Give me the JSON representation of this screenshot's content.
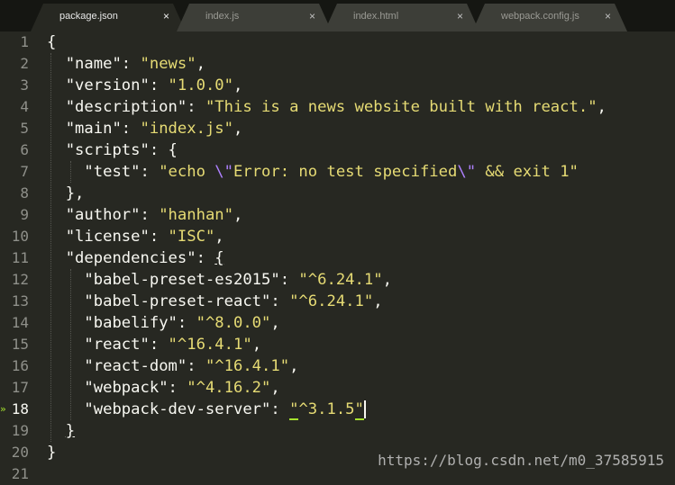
{
  "tabs": [
    {
      "label": "package.json",
      "active": true
    },
    {
      "label": "index.js",
      "active": false
    },
    {
      "label": "index.html",
      "active": false
    },
    {
      "label": "webpack.config.js",
      "active": false
    }
  ],
  "tab_close_glyph": "×",
  "gutter": {
    "lines": [
      "1",
      "2",
      "3",
      "4",
      "5",
      "6",
      "7",
      "8",
      "9",
      "10",
      "11",
      "12",
      "13",
      "14",
      "15",
      "16",
      "17",
      "18",
      "19",
      "20",
      "21"
    ],
    "current_line": "18",
    "change_marker": "»"
  },
  "code": {
    "l1": "{",
    "l2_k": "\"name\"",
    "l2_v": "\"news\"",
    "l3_k": "\"version\"",
    "l3_v": "\"1.0.0\"",
    "l4_k": "\"description\"",
    "l4_v": "\"This is a news website built with react.\"",
    "l5_k": "\"main\"",
    "l5_v": "\"index.js\"",
    "l6_k": "\"scripts\"",
    "l7_k": "\"test\"",
    "l7_v1": "\"echo ",
    "l7_e1": "\\\"",
    "l7_v2": "Error: no test specified",
    "l7_e2": "\\\"",
    "l7_v3": " && exit 1\"",
    "l9_k": "\"author\"",
    "l9_v": "\"hanhan\"",
    "l10_k": "\"license\"",
    "l10_v": "\"ISC\"",
    "l11_k": "\"dependencies\"",
    "l12_k": "\"babel-preset-es2015\"",
    "l12_v": "\"^6.24.1\"",
    "l13_k": "\"babel-preset-react\"",
    "l13_v": "\"^6.24.1\"",
    "l14_k": "\"babelify\"",
    "l14_v": "\"^8.0.0\"",
    "l15_k": "\"react\"",
    "l15_v": "\"^16.4.1\"",
    "l16_k": "\"react-dom\"",
    "l16_v": "\"^16.4.1\"",
    "l17_k": "\"webpack\"",
    "l17_v": "\"^4.16.2\"",
    "l18_k": "\"webpack-dev-server\"",
    "l18_v_open": "\"",
    "l18_v_body": "^3.1.5",
    "l18_v_close": "\""
  },
  "watermark": "https://blog.csdn.net/m0_37585915",
  "colors": {
    "background": "#272822",
    "string": "#e6db74",
    "escape": "#ae81ff",
    "text": "#f8f8f2"
  }
}
